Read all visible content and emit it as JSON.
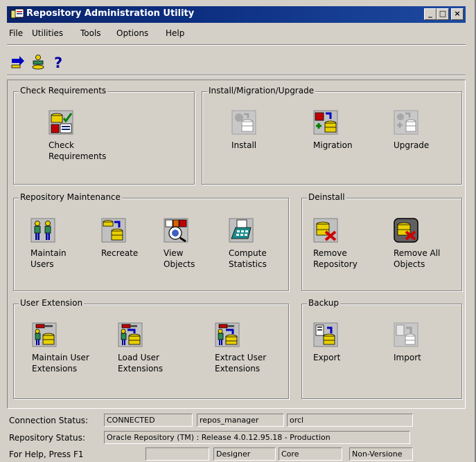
{
  "window": {
    "title": "Repository Administration Utility",
    "buttons": [
      "_",
      "□",
      "×"
    ]
  },
  "menu": [
    "File",
    "Utilities",
    "Tools",
    "Options",
    "Help"
  ],
  "toolbar": {
    "icons": [
      "connect-arrow-icon",
      "load-user-icon",
      "help-question-icon"
    ]
  },
  "groups": {
    "check_requirements": {
      "legend": "Check Requirements",
      "tiles": [
        {
          "label": "Check\nRequirements",
          "icon": "check-requirements-icon"
        }
      ]
    },
    "install": {
      "legend": "Install/Migration/Upgrade",
      "tiles": [
        {
          "label": "Install",
          "icon": "install-icon"
        },
        {
          "label": "Migration",
          "icon": "migration-icon"
        },
        {
          "label": "Upgrade",
          "icon": "upgrade-icon"
        }
      ]
    },
    "maintenance": {
      "legend": "Repository Maintenance",
      "tiles": [
        {
          "label": "Maintain\nUsers",
          "icon": "users-icon"
        },
        {
          "label": "Recreate",
          "icon": "recreate-icon"
        },
        {
          "label": "View\nObjects",
          "icon": "view-objects-icon"
        },
        {
          "label": "Compute\nStatistics",
          "icon": "calculator-icon"
        }
      ]
    },
    "deinstall": {
      "legend": "Deinstall",
      "tiles": [
        {
          "label": "Remove\nRepository",
          "icon": "remove-repository-icon"
        },
        {
          "label": "Remove All\nObjects",
          "icon": "remove-all-objects-icon"
        }
      ]
    },
    "user_extension": {
      "legend": "User Extension",
      "tiles": [
        {
          "label": "Maintain User\nExtensions",
          "icon": "maintain-user-extensions-icon"
        },
        {
          "label": "Load User\nExtensions",
          "icon": "load-user-extensions-icon"
        },
        {
          "label": "Extract User\nExtensions",
          "icon": "extract-user-extensions-icon"
        }
      ]
    },
    "backup": {
      "legend": "Backup",
      "tiles": [
        {
          "label": "Export",
          "icon": "export-icon"
        },
        {
          "label": "Import",
          "icon": "import-icon"
        }
      ]
    }
  },
  "status": {
    "connection": {
      "caption": "Connection Status:",
      "state": "CONNECTED",
      "user": "repos_manager",
      "db": "orcl"
    },
    "repository": {
      "caption": "Repository Status:",
      "value": "Oracle Repository (TM) : Release 4.0.12.95.18 - Production"
    },
    "help": {
      "caption": "For Help, Press F1",
      "blank": "",
      "tool": "Designer",
      "area": "Core",
      "mode": "Non-Versione"
    }
  }
}
